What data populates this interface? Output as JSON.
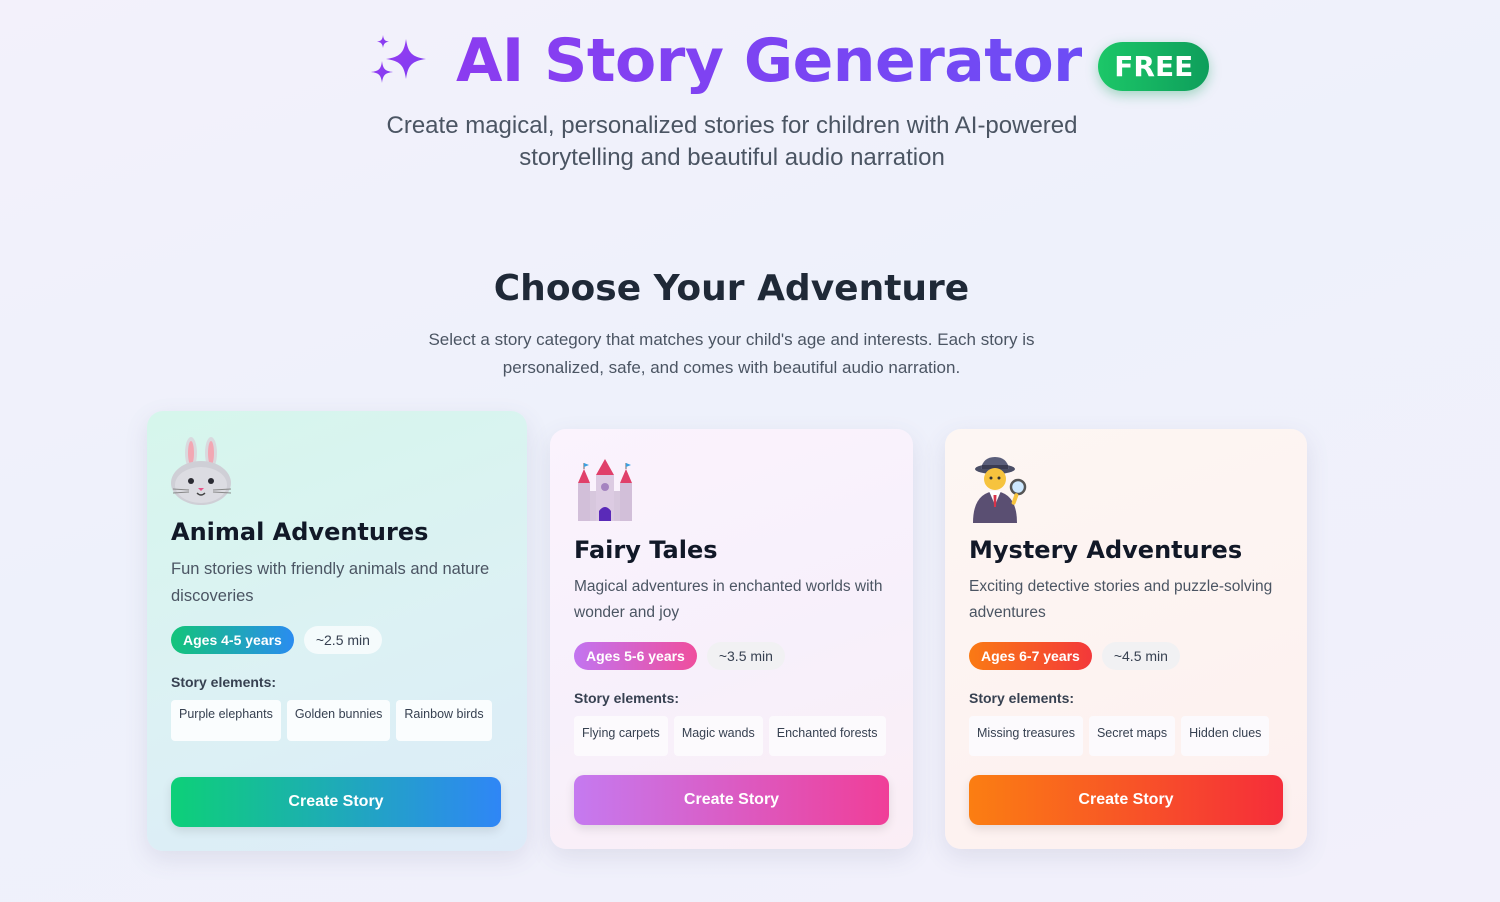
{
  "header": {
    "icon": "sparkles-icon",
    "title": "AI Story Generator",
    "badge": "FREE",
    "subtitle": "Create magical, personalized stories for children with AI-powered storytelling and beautiful audio narration"
  },
  "section": {
    "title": "Choose Your Adventure",
    "description": "Select a story category that matches your child's age and interests. Each story is personalized, safe, and comes with beautiful audio narration."
  },
  "cards": [
    {
      "icon": "rabbit-icon",
      "title": "Animal Adventures",
      "description": "Fun stories with friendly animals and nature discoveries",
      "age": "Ages 4-5 years",
      "duration": "~2.5 min",
      "elements_label": "Story elements:",
      "elements": [
        "Purple elephants",
        "Golden bunnies",
        "Rainbow birds"
      ],
      "button": "Create Story"
    },
    {
      "icon": "castle-icon",
      "title": "Fairy Tales",
      "description": "Magical adventures in enchanted worlds with wonder and joy",
      "age": "Ages 5-6 years",
      "duration": "~3.5 min",
      "elements_label": "Story elements:",
      "elements": [
        "Flying carpets",
        "Magic wands",
        "Enchanted forests"
      ],
      "button": "Create Story"
    },
    {
      "icon": "detective-icon",
      "title": "Mystery Adventures",
      "description": "Exciting detective stories and puzzle-solving adventures",
      "age": "Ages 6-7 years",
      "duration": "~4.5 min",
      "elements_label": "Story elements:",
      "elements": [
        "Missing treasures",
        "Secret maps",
        "Hidden clues"
      ],
      "button": "Create Story"
    }
  ]
}
